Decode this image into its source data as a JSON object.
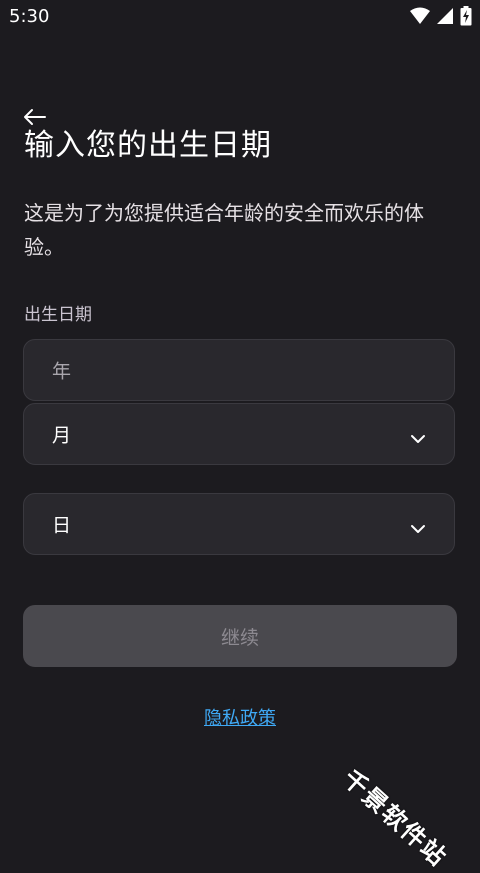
{
  "status_bar": {
    "time": "5:30"
  },
  "header": {
    "title": "输入您的出生日期"
  },
  "subtitle": "这是为了为您提供适合年龄的安全而欢乐的体验。",
  "form": {
    "label": "出生日期",
    "year_placeholder": "年",
    "month_value": "月",
    "day_value": "日"
  },
  "continue_label": "继续",
  "privacy_link": "隐私政策",
  "watermark": "千景软件站",
  "colors": {
    "link": "#3fa9f5",
    "background": "#1c1b1f",
    "disabled_button": "#4a494e"
  }
}
